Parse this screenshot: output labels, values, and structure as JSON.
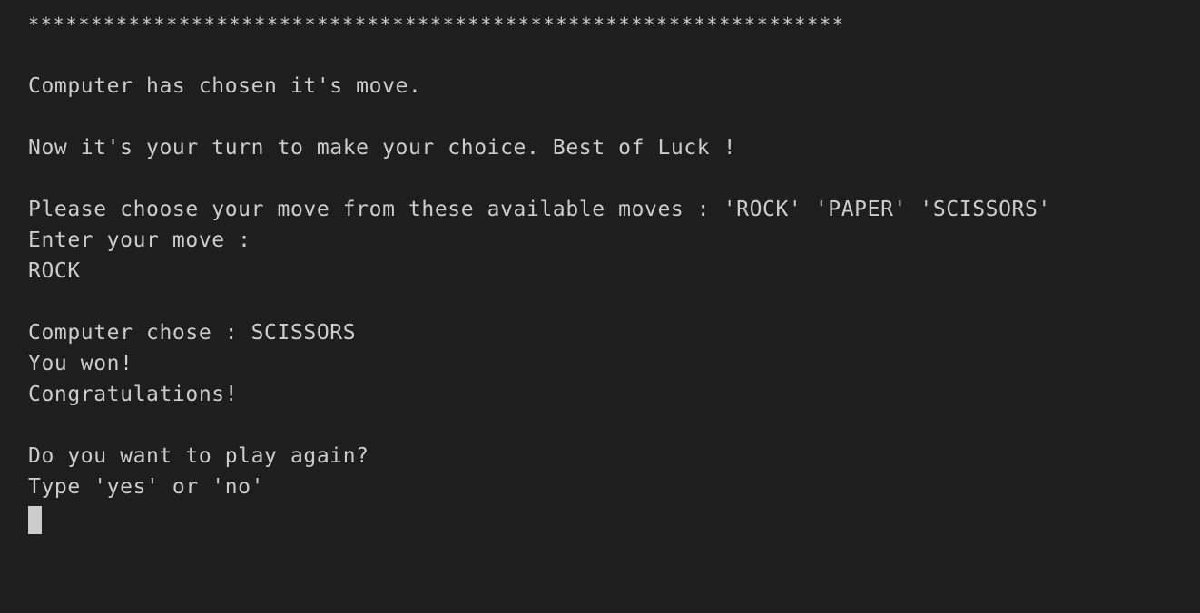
{
  "terminal": {
    "lines": [
      "*****************************************************************",
      "",
      "Computer has chosen it's move.",
      "",
      "Now it's your turn to make your choice. Best of Luck !",
      "",
      "Please choose your move from these available moves : 'ROCK' 'PAPER' 'SCISSORS'",
      "Enter your move :",
      "ROCK",
      "",
      "Computer chose : SCISSORS",
      "You won!",
      "Congratulations!",
      "",
      "Do you want to play again?",
      "Type 'yes' or 'no'"
    ]
  },
  "colors": {
    "background": "#1e1e1e",
    "text": "#cccccc",
    "cursor": "#cccccc"
  }
}
